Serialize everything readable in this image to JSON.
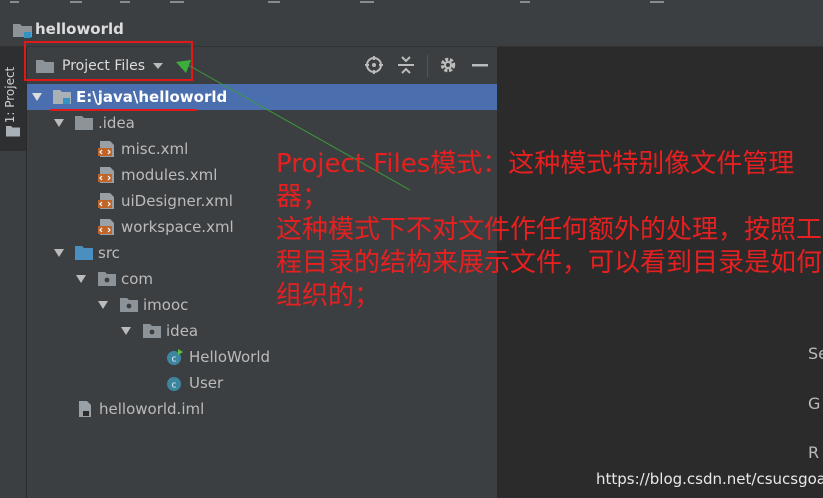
{
  "window": {
    "title": "helloworld"
  },
  "tool_strip": {
    "project_tab_label": "1: Project"
  },
  "project_panel": {
    "view_mode_label": "Project Files",
    "header_icons": [
      "crosshair-icon",
      "collapse-all-icon",
      "gear-icon",
      "minimize-icon"
    ],
    "tree": [
      {
        "label": "E:\\java\\helloworld",
        "icon": "module-folder-icon",
        "expanded": true,
        "selected": true
      },
      {
        "label": ".idea",
        "icon": "folder-icon",
        "expanded": true
      },
      {
        "label": "misc.xml",
        "icon": "xml-file-icon"
      },
      {
        "label": "modules.xml",
        "icon": "xml-file-icon"
      },
      {
        "label": "uiDesigner.xml",
        "icon": "xml-file-icon"
      },
      {
        "label": "workspace.xml",
        "icon": "xml-file-icon"
      },
      {
        "label": "src",
        "icon": "source-folder-icon",
        "expanded": true
      },
      {
        "label": "com",
        "icon": "package-icon",
        "expanded": true
      },
      {
        "label": "imooc",
        "icon": "package-icon",
        "expanded": true
      },
      {
        "label": "idea",
        "icon": "package-icon",
        "expanded": true
      },
      {
        "label": "HelloWorld",
        "icon": "java-class-main-icon"
      },
      {
        "label": "User",
        "icon": "java-class-icon"
      },
      {
        "label": "helloworld.iml",
        "icon": "iml-file-icon"
      }
    ]
  },
  "editor_peek": [
    "Se",
    "G",
    "R"
  ],
  "annotation": {
    "text": "Project Files模式：这种模式特别像文件管理器；\n这种模式下不对文件作任何额外的处理，按照工程目录的结构来展示文件，可以看到目录是如何组织的；"
  },
  "watermark": "https://blog.csdn.net/csucsgoat",
  "colors": {
    "panel_bg": "#3c3f41",
    "editor_bg": "#2b2b2b",
    "selection": "#4b6eaf",
    "annotation_red": "#e62020",
    "pointer_line": "#3c9a3c",
    "folder": "#8c9399",
    "source_folder": "#4a8fbf",
    "xml_icon": "#c0652a",
    "class_icon": "#3e86a0"
  }
}
